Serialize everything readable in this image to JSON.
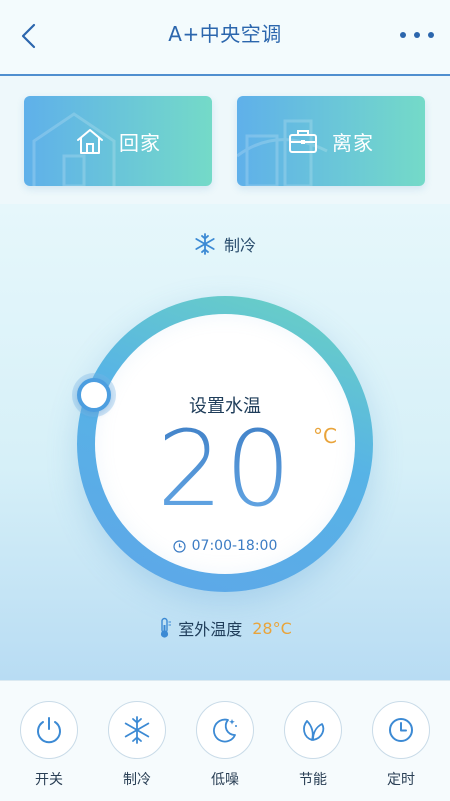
{
  "header": {
    "title": "A+中央空调"
  },
  "mode_buttons": [
    {
      "label": "回家",
      "icon": "home-icon"
    },
    {
      "label": "离家",
      "icon": "briefcase-icon"
    }
  ],
  "current_mode": {
    "label": "制冷",
    "icon": "snowflake-icon"
  },
  "dial": {
    "set_label": "设置水温",
    "temperature": "20",
    "unit": "°C",
    "schedule": "07:00-18:00"
  },
  "outdoor": {
    "label": "室外温度",
    "value": "28°C"
  },
  "bottom_tabs": [
    {
      "label": "开关",
      "icon": "power-icon"
    },
    {
      "label": "制冷",
      "icon": "snowflake-icon"
    },
    {
      "label": "低噪",
      "icon": "moon-icon"
    },
    {
      "label": "节能",
      "icon": "leaf-icon"
    },
    {
      "label": "定时",
      "icon": "clock-icon"
    }
  ],
  "colors": {
    "accent": "#2b66ad",
    "warm": "#e9a43b",
    "teal": "#74dac8"
  }
}
